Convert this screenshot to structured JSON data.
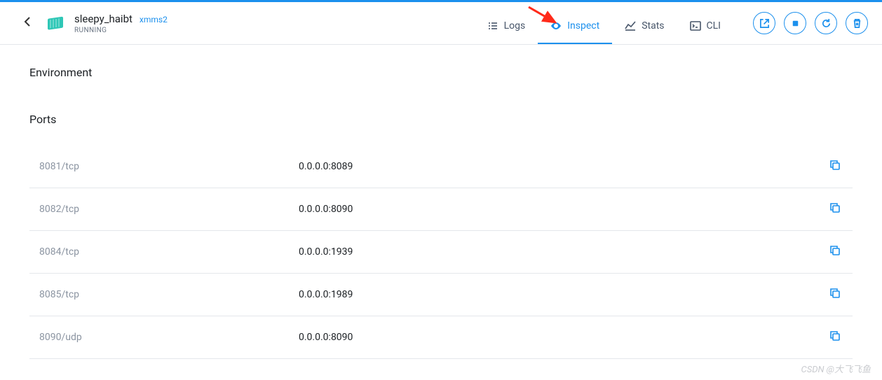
{
  "header": {
    "container_name": "sleepy_haibt",
    "image_name": "xmms2",
    "status": "RUNNING"
  },
  "tabs": [
    {
      "id": "logs",
      "label": "Logs",
      "active": false
    },
    {
      "id": "inspect",
      "label": "Inspect",
      "active": true
    },
    {
      "id": "stats",
      "label": "Stats",
      "active": false
    },
    {
      "id": "cli",
      "label": "CLI",
      "active": false
    }
  ],
  "sections": {
    "environment_title": "Environment",
    "ports_title": "Ports"
  },
  "ports": [
    {
      "proto": "8081/tcp",
      "hostport": "0.0.0.0:8089"
    },
    {
      "proto": "8082/tcp",
      "hostport": "0.0.0.0:8090"
    },
    {
      "proto": "8084/tcp",
      "hostport": "0.0.0.0:1939"
    },
    {
      "proto": "8085/tcp",
      "hostport": "0.0.0.0:1989"
    },
    {
      "proto": "8090/udp",
      "hostport": "0.0.0.0:8090"
    }
  ],
  "watermark": "CSDN @大飞飞鱼"
}
